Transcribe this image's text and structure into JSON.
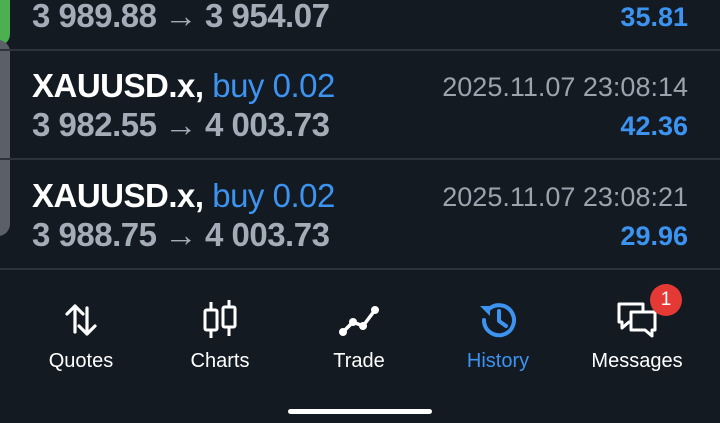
{
  "trades": [
    {
      "symbol": "",
      "action": "",
      "open_price": "3 989.88",
      "arrow": "→",
      "close_price": "3 954.07",
      "time": "",
      "profit": "35.81"
    },
    {
      "symbol": "XAUUSD.x,",
      "action": "buy 0.02",
      "open_price": "3 982.55",
      "arrow": "→",
      "close_price": "4 003.73",
      "time": "2025.11.07 23:08:14",
      "profit": "42.36"
    },
    {
      "symbol": "XAUUSD.x,",
      "action": "buy 0.02",
      "open_price": "3 988.75",
      "arrow": "→",
      "close_price": "4 003.73",
      "time": "2025.11.07 23:08:21",
      "profit": "29.96"
    }
  ],
  "nav": {
    "quotes": "Quotes",
    "charts": "Charts",
    "trade": "Trade",
    "history": "History",
    "messages": "Messages",
    "messages_badge": "1",
    "active": "history"
  },
  "colors": {
    "background": "#131a22",
    "accent": "#3c93f0",
    "badge": "#e53935",
    "side_handle_green": "#4caf50"
  }
}
